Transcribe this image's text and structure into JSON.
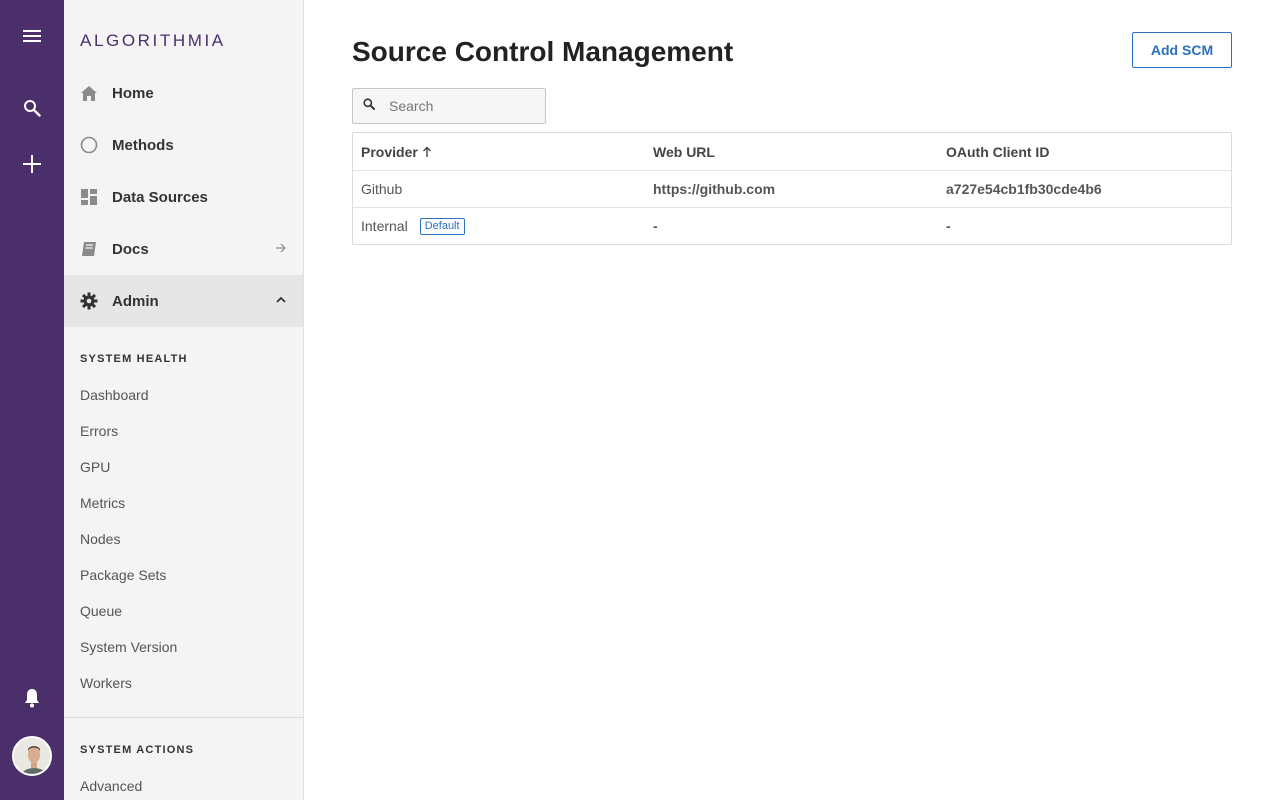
{
  "app": {
    "logo_text": "ALGORITHMIA"
  },
  "rail": {
    "menu_icon": "hamburger-icon",
    "search_icon": "search-icon",
    "add_icon": "plus-icon",
    "notifications_icon": "bell-icon",
    "avatar": "user-avatar"
  },
  "sidebar": {
    "nav": [
      {
        "label": "Home",
        "icon": "home-icon"
      },
      {
        "label": "Methods",
        "icon": "circle-icon"
      },
      {
        "label": "Data Sources",
        "icon": "dashboard-icon"
      },
      {
        "label": "Docs",
        "icon": "book-icon",
        "trail_icon": "arrow-right-icon"
      },
      {
        "label": "Admin",
        "icon": "gear-icon",
        "trail_icon": "chevron-up-icon",
        "active": true
      }
    ],
    "system_health": {
      "title": "SYSTEM HEALTH",
      "items": [
        "Dashboard",
        "Errors",
        "GPU",
        "Metrics",
        "Nodes",
        "Package Sets",
        "Queue",
        "System Version",
        "Workers"
      ]
    },
    "system_actions": {
      "title": "SYSTEM ACTIONS",
      "items": [
        "Advanced"
      ]
    }
  },
  "main": {
    "title": "Source Control Management",
    "add_button_label": "Add SCM",
    "search": {
      "placeholder": "Search",
      "value": ""
    },
    "table": {
      "columns": [
        "Provider",
        "Web URL",
        "OAuth Client ID"
      ],
      "sort_icon": "arrow-up-icon",
      "rows": [
        {
          "provider": "Github",
          "badge": "",
          "web_url": "https://github.com",
          "client_id": "a727e54cb1fb30cde4b6"
        },
        {
          "provider": "Internal",
          "badge": "Default",
          "web_url": "-",
          "client_id": "-"
        }
      ]
    }
  },
  "colors": {
    "rail": "#4a2f6b",
    "accent": "#2d6fc0",
    "sidebar": "#f4f4f4"
  }
}
